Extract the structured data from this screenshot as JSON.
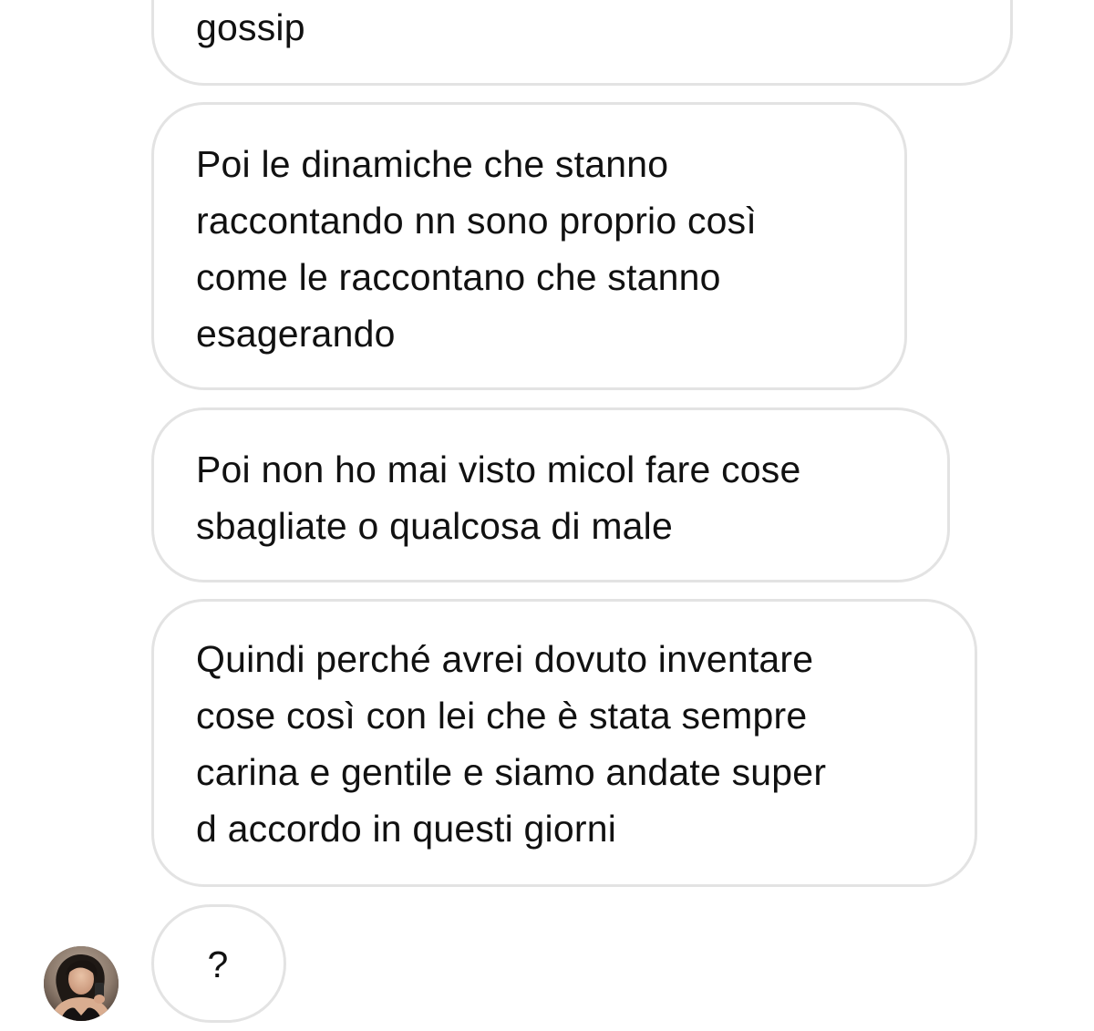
{
  "conversation": {
    "messages": [
      {
        "text": "gossip"
      },
      {
        "text": "Poi le dinamiche che stanno\nraccontando nn sono proprio così\ncome le raccontano che stanno\nesagerando"
      },
      {
        "text": "Poi non ho mai visto micol fare cose\nsbagliate o qualcosa di male"
      },
      {
        "text": "Quindi perché avrei dovuto inventare\ncose così con lei che è stata sempre\ncarina e gentile e siamo andate super\nd accordo in questi giorni"
      },
      {
        "text": "?"
      }
    ],
    "sender_avatar_icon": "profile-photo-avatar",
    "colors": {
      "bubble_border": "#e3e3e3",
      "bubble_background": "#ffffff",
      "text": "#111111",
      "page_background": "#ffffff"
    }
  }
}
